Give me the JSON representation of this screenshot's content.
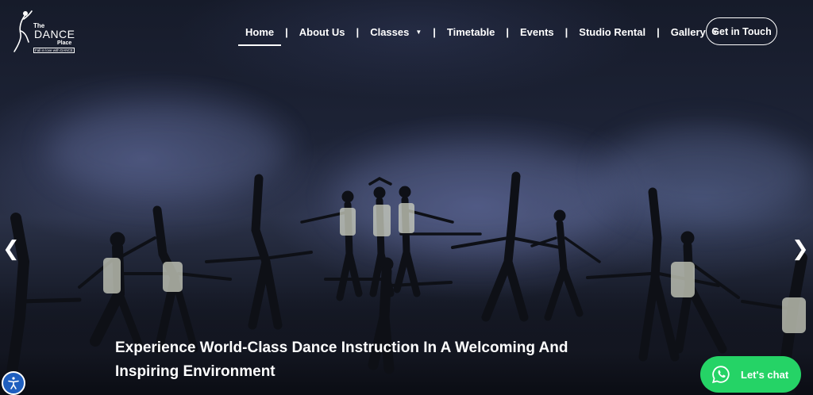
{
  "logo": {
    "the": "The",
    "dance": "DANCE",
    "place": "Place",
    "tagline": "Fall in love with DANCE"
  },
  "nav": {
    "items": [
      {
        "label": "Home"
      },
      {
        "label": "About Us"
      },
      {
        "label": "Classes"
      },
      {
        "label": "Timetable"
      },
      {
        "label": "Events"
      },
      {
        "label": "Studio Rental"
      },
      {
        "label": "Gallery"
      }
    ],
    "active": "Home",
    "separator": "|",
    "cta_label": "Get in Touch"
  },
  "hero": {
    "headline_line1": "Experience World-Class Dance Instruction In A Welcoming And",
    "headline_line2": "Inspiring Environment"
  },
  "slider": {
    "prev_icon": "chevron-left-icon",
    "next_icon": "chevron-right-icon"
  },
  "chat": {
    "label": "Let's chat",
    "icon": "whatsapp-icon",
    "color": "#25d366"
  },
  "accessibility": {
    "icon": "accessibility-icon",
    "color": "#1f5fbf"
  }
}
